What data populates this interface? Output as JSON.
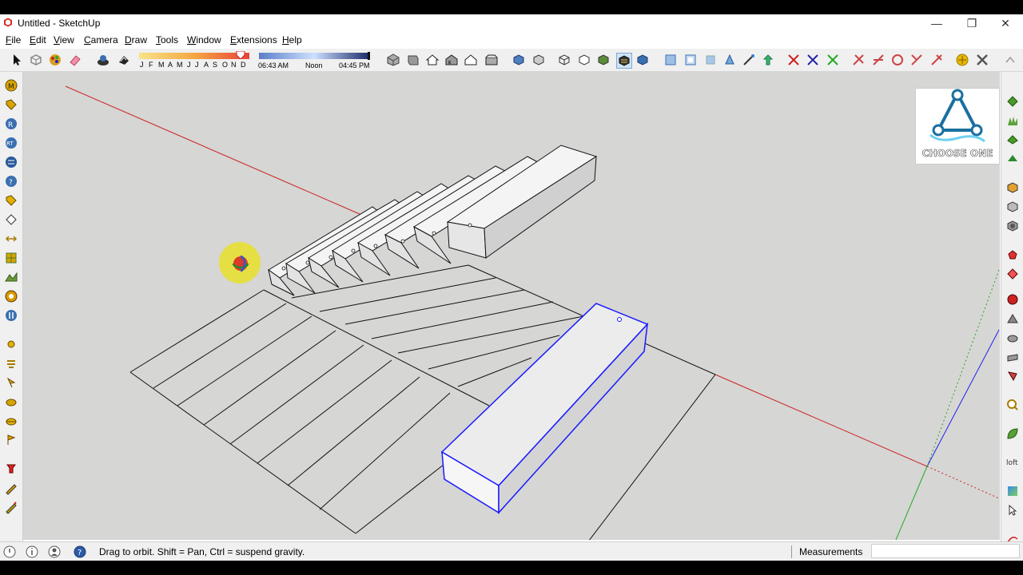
{
  "window": {
    "title": "Untitled - SketchUp",
    "controls": [
      "minimize-icon",
      "restore-icon",
      "close-icon"
    ]
  },
  "menu": {
    "items": [
      "File",
      "Edit",
      "View",
      "Camera",
      "Draw",
      "Tools",
      "Window",
      "Extensions",
      "Help"
    ]
  },
  "shadow_settings": {
    "months": [
      "J",
      "F",
      "M",
      "A",
      "M",
      "J",
      "J",
      "A",
      "S",
      "O",
      "N",
      "D"
    ],
    "time_start": "06:43 AM",
    "time_mid": "Noon",
    "time_end": "04:45 PM"
  },
  "logo": {
    "text": "CHOOSE ONE"
  },
  "status": {
    "message": "Drag to orbit. Shift = Pan, Ctrl = suspend gravity.",
    "measurements_label": "Measurements",
    "measurements_value": ""
  },
  "colors": {
    "axis_red": "#cc2222",
    "axis_green": "#22aa22",
    "axis_blue": "#2222ee",
    "selection_blue": "#1a1aff",
    "viewport_bg": "#d6d6d4",
    "face_fill": "#ebebeb"
  }
}
